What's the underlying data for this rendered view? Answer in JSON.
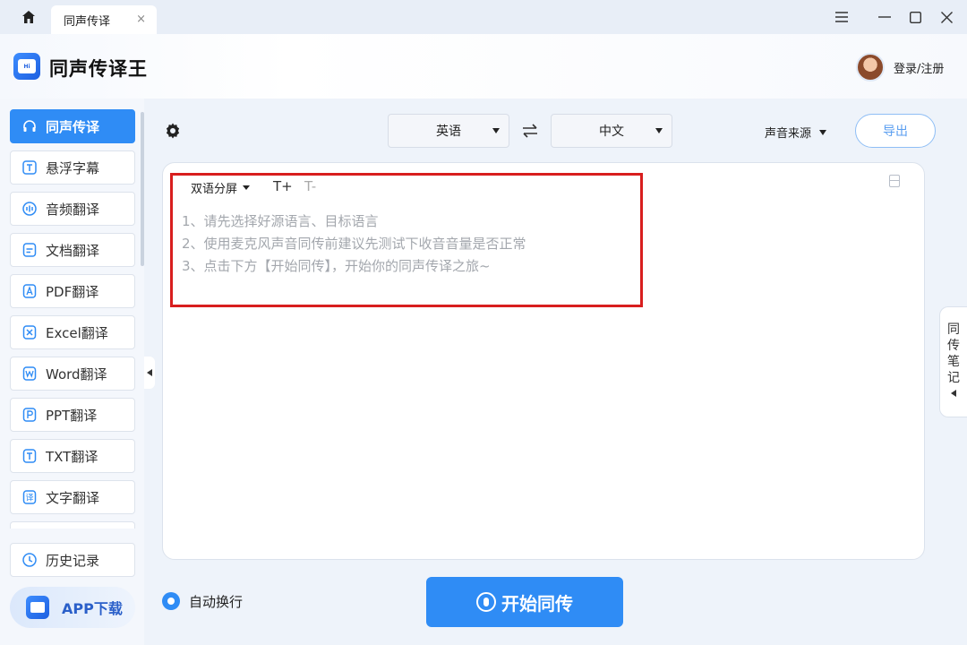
{
  "window": {
    "tab_title": "同声传译",
    "tab_close": "×"
  },
  "header": {
    "app_title": "同声传译王",
    "login_label": "登录/注册"
  },
  "sidebar": {
    "items": [
      {
        "label": "同声传译",
        "icon": "headphones-icon",
        "active": true
      },
      {
        "label": "悬浮字幕",
        "icon": "text-frame-icon"
      },
      {
        "label": "音频翻译",
        "icon": "audio-wave-icon"
      },
      {
        "label": "文档翻译",
        "icon": "document-icon"
      },
      {
        "label": "PDF翻译",
        "icon": "pdf-icon"
      },
      {
        "label": "Excel翻译",
        "icon": "excel-icon"
      },
      {
        "label": "Word翻译",
        "icon": "word-icon"
      },
      {
        "label": "PPT翻译",
        "icon": "ppt-icon"
      },
      {
        "label": "TXT翻译",
        "icon": "txt-icon"
      },
      {
        "label": "文字翻译",
        "icon": "translate-char-icon"
      }
    ],
    "history_label": "历史记录",
    "app_download_label": "APP下载"
  },
  "toolbar": {
    "source_lang": "英语",
    "target_lang": "中文",
    "sound_source_label": "声音来源",
    "export_label": "导出"
  },
  "panel": {
    "bilingual_label": "双语分屏",
    "font_increase": "T+",
    "font_decrease": "T-",
    "hints": [
      "1、请先选择好源语言、目标语言",
      "2、使用麦克风声音同传前建议先测试下收音音量是否正常",
      "3、点击下方【开始同传】，开始你的同声传译之旅~"
    ]
  },
  "notes_tab": {
    "chars": [
      "同",
      "传",
      "笔",
      "记"
    ]
  },
  "footer": {
    "auto_wrap_label": "自动换行",
    "start_label": "开始同传"
  },
  "colors": {
    "accent": "#2f8cf5",
    "highlight_box": "#d81e1e",
    "hint_text": "#a3a7ad"
  }
}
